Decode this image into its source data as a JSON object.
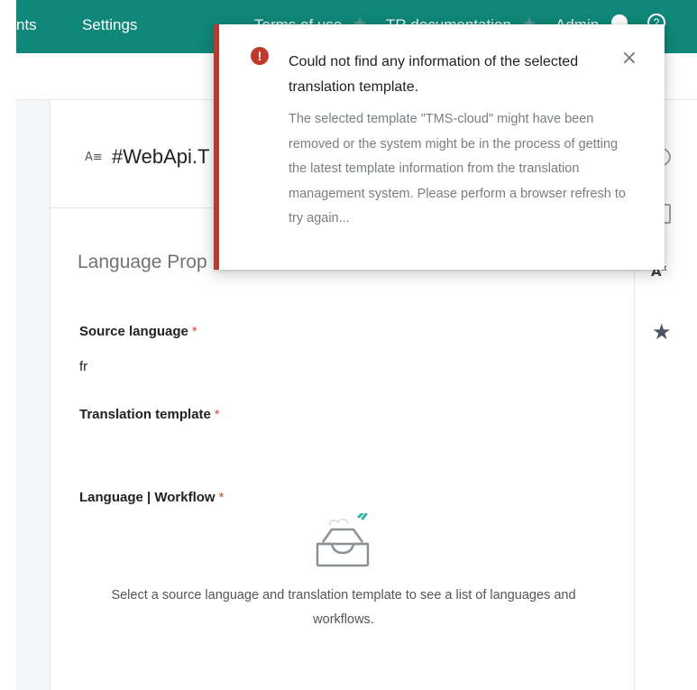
{
  "topbar": {
    "components_label": "nts",
    "settings_label": "Settings",
    "terms_label": "Terms of use",
    "docs_label": "TR documentation",
    "admin_label": "Admin",
    "help_label": "?",
    "color": "#0f8879"
  },
  "card": {
    "title": "#WebApi.T",
    "section_title": "Language Prop",
    "fields": {
      "source_label": "Source language",
      "source_value": "fr",
      "template_label": "Translation template",
      "workflow_label": "Language | Workflow",
      "required_marker": "*"
    },
    "empty_state_text": "Select a source language and translation template to see a list of languages and workflows."
  },
  "right_rail": {
    "icons": [
      "history-icon",
      "document-icon",
      "translate-icon",
      "star-icon"
    ],
    "translate_text": "A",
    "translate_sup": "x"
  },
  "toast": {
    "icon_glyph": "!",
    "title": "Could not find any information of the selected translation template.",
    "body": "The selected template \"TMS-cloud\" might have been removed or the system might be in the process of getting the latest template information from the translation management system. Please perform a browser refresh to try again...",
    "close_glyph": "×",
    "accent_color": "#b83a2e"
  }
}
